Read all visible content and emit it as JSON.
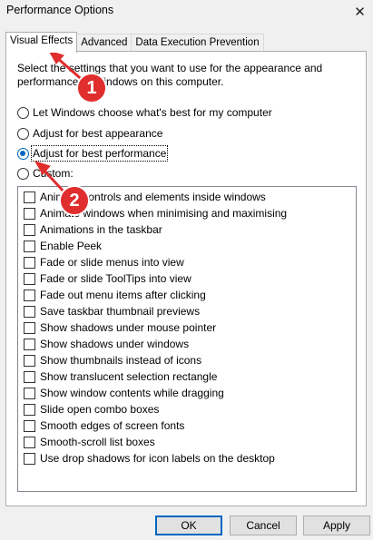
{
  "window": {
    "title": "Performance Options",
    "close_glyph": "✕"
  },
  "tabs": [
    {
      "label": "Visual Effects",
      "active": true
    },
    {
      "label": "Advanced",
      "active": false
    },
    {
      "label": "Data Execution Prevention",
      "active": false
    }
  ],
  "intro_text": "Select the settings that you want to use for the appearance and performance of Windows on this computer.",
  "radios": [
    {
      "label": "Let Windows choose what's best for my computer",
      "checked": false
    },
    {
      "label": "Adjust for best appearance",
      "checked": false
    },
    {
      "label": "Adjust for best performance",
      "checked": true
    },
    {
      "label": "Custom:",
      "checked": false
    }
  ],
  "effects": [
    {
      "label": "Animate controls and elements inside windows",
      "checked": false
    },
    {
      "label": "Animate windows when minimising and maximising",
      "checked": false
    },
    {
      "label": "Animations in the taskbar",
      "checked": false
    },
    {
      "label": "Enable Peek",
      "checked": false
    },
    {
      "label": "Fade or slide menus into view",
      "checked": false
    },
    {
      "label": "Fade or slide ToolTips into view",
      "checked": false
    },
    {
      "label": "Fade out menu items after clicking",
      "checked": false
    },
    {
      "label": "Save taskbar thumbnail previews",
      "checked": false
    },
    {
      "label": "Show shadows under mouse pointer",
      "checked": false
    },
    {
      "label": "Show shadows under windows",
      "checked": false
    },
    {
      "label": "Show thumbnails instead of icons",
      "checked": false
    },
    {
      "label": "Show translucent selection rectangle",
      "checked": false
    },
    {
      "label": "Show window contents while dragging",
      "checked": false
    },
    {
      "label": "Slide open combo boxes",
      "checked": false
    },
    {
      "label": "Smooth edges of screen fonts",
      "checked": false
    },
    {
      "label": "Smooth-scroll list boxes",
      "checked": false
    },
    {
      "label": "Use drop shadows for icon labels on the desktop",
      "checked": false
    }
  ],
  "buttons": {
    "ok": "OK",
    "cancel": "Cancel",
    "apply": "Apply"
  },
  "annotations": {
    "color": "#e02d2d",
    "marker_1": "1",
    "marker_2": "2"
  }
}
